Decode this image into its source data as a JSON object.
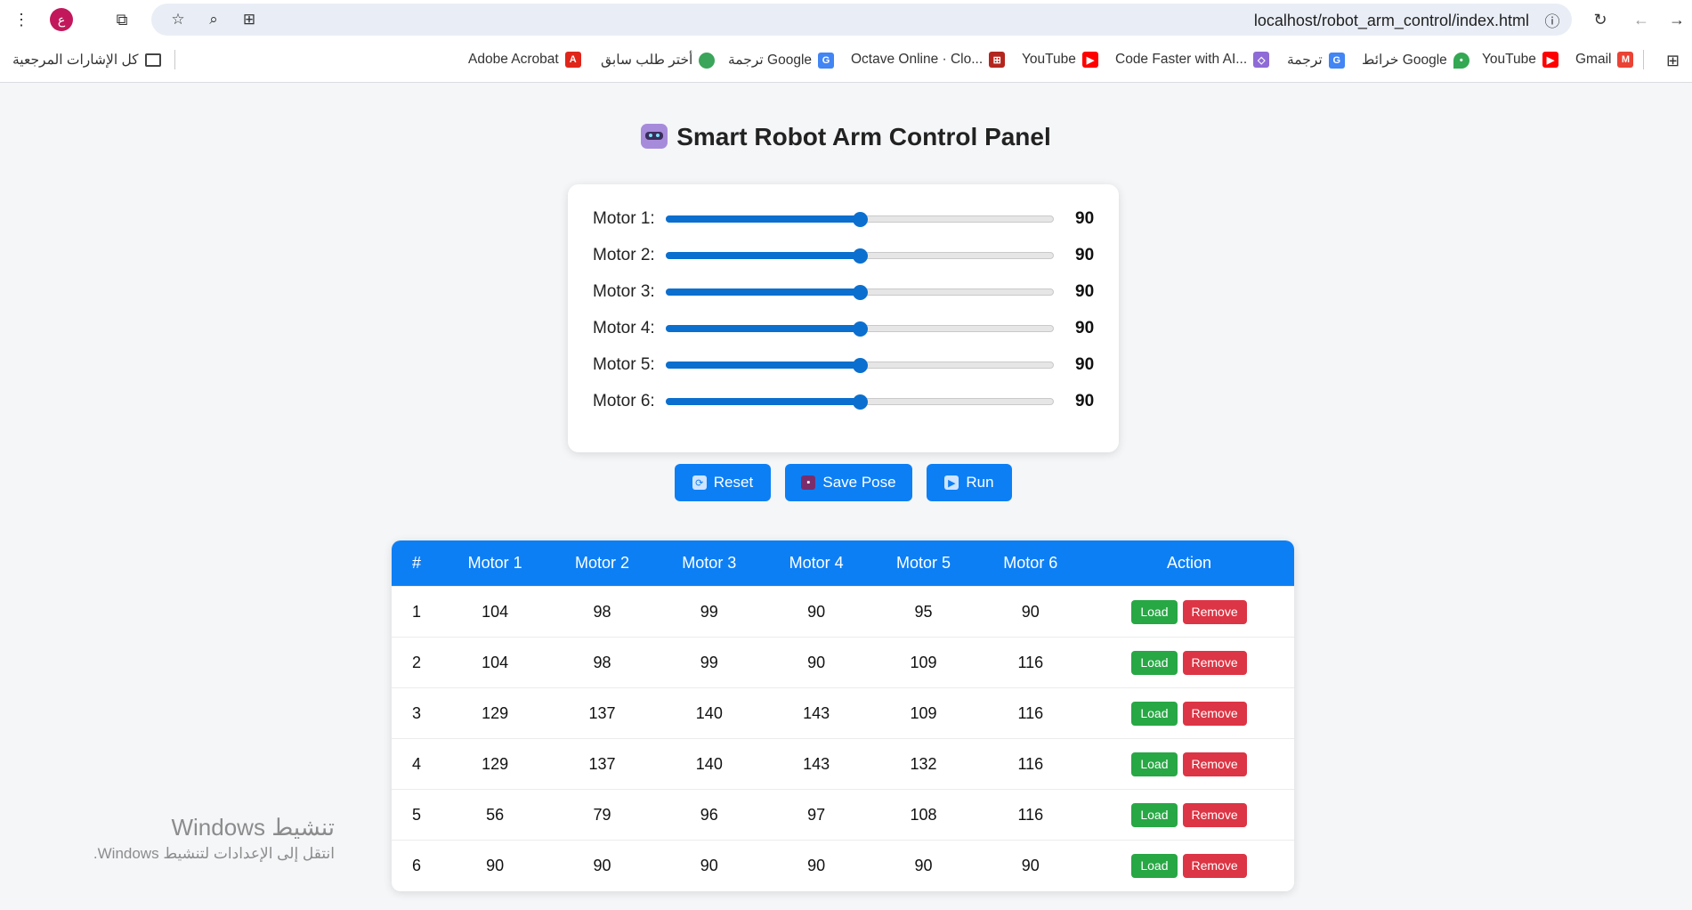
{
  "browser": {
    "profile_initial": "ع",
    "url": "localhost/robot_arm_control/index.html",
    "bookmarks": [
      {
        "label": "Gmail",
        "icon": "gmail-icon"
      },
      {
        "label": "YouTube",
        "icon": "youtube-icon"
      },
      {
        "label": "خرائط Google",
        "icon": "maps-icon"
      },
      {
        "label": "ترجمة",
        "icon": "translate-icon"
      },
      {
        "label": "Code Faster with AI...",
        "icon": "code-icon"
      },
      {
        "label": "YouTube",
        "icon": "youtube-icon"
      },
      {
        "label": "Octave Online · Clo...",
        "icon": "octave-icon"
      },
      {
        "label": "ترجمة Google",
        "icon": "translate-icon"
      },
      {
        "label": "أختر طلب سابق",
        "icon": "leaf-icon"
      },
      {
        "label": "Adobe Acrobat",
        "icon": "acrobat-icon"
      },
      {
        "label": "كل الإشارات المرجعية",
        "icon": "folder-icon"
      }
    ]
  },
  "page": {
    "title": "Smart Robot Arm Control Panel"
  },
  "motors": [
    {
      "label": "Motor 1:",
      "value": "90",
      "min": 0,
      "max": 180
    },
    {
      "label": "Motor 2:",
      "value": "90",
      "min": 0,
      "max": 180
    },
    {
      "label": "Motor 3:",
      "value": "90",
      "min": 0,
      "max": 180
    },
    {
      "label": "Motor 4:",
      "value": "90",
      "min": 0,
      "max": 180
    },
    {
      "label": "Motor 5:",
      "value": "90",
      "min": 0,
      "max": 180
    },
    {
      "label": "Motor 6:",
      "value": "90",
      "min": 0,
      "max": 180
    }
  ],
  "buttons": {
    "reset": "Reset",
    "save": "Save Pose",
    "run": "Run"
  },
  "table": {
    "headers": [
      "#",
      "Motor 1",
      "Motor 2",
      "Motor 3",
      "Motor 4",
      "Motor 5",
      "Motor 6",
      "Action"
    ],
    "load_label": "Load",
    "remove_label": "Remove",
    "rows": [
      [
        "1",
        "104",
        "98",
        "99",
        "90",
        "95",
        "90"
      ],
      [
        "2",
        "104",
        "98",
        "99",
        "90",
        "109",
        "116"
      ],
      [
        "3",
        "129",
        "137",
        "140",
        "143",
        "109",
        "116"
      ],
      [
        "4",
        "129",
        "137",
        "140",
        "143",
        "132",
        "116"
      ],
      [
        "5",
        "56",
        "79",
        "96",
        "97",
        "108",
        "116"
      ],
      [
        "6",
        "90",
        "90",
        "90",
        "90",
        "90",
        "90"
      ]
    ]
  },
  "watermark": {
    "line1": "تنشيط Windows",
    "line2": "انتقل إلى الإعدادات لتنشيط Windows."
  },
  "colors": {
    "primary": "#0d7ff5",
    "slider": "#0b6fcf",
    "load": "#28a745",
    "remove": "#dc3545"
  }
}
